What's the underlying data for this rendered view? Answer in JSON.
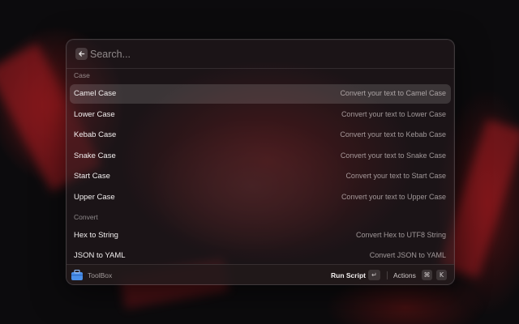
{
  "search": {
    "placeholder": "Search...",
    "value": ""
  },
  "sections": [
    {
      "title": "Case",
      "items": [
        {
          "title": "Camel Case",
          "subtitle": "Convert your text to Camel Case",
          "selected": true
        },
        {
          "title": "Lower Case",
          "subtitle": "Convert your text to Lower Case"
        },
        {
          "title": "Kebab Case",
          "subtitle": "Convert your text to Kebab Case"
        },
        {
          "title": "Snake Case",
          "subtitle": "Convert your text to Snake Case"
        },
        {
          "title": "Start Case",
          "subtitle": "Convert your text to Start Case"
        },
        {
          "title": "Upper Case",
          "subtitle": "Convert your text to Upper Case"
        }
      ]
    },
    {
      "title": "Convert",
      "items": [
        {
          "title": "Hex to String",
          "subtitle": "Convert Hex to UTF8 String"
        },
        {
          "title": "JSON to YAML",
          "subtitle": "Convert JSON to YAML"
        }
      ]
    }
  ],
  "footer": {
    "app_name": "ToolBox",
    "app_icon": "toolbox-icon",
    "primary_action": "Run Script",
    "primary_key": "↵",
    "actions_label": "Actions",
    "actions_keys": [
      "⌘",
      "K"
    ]
  },
  "colors": {
    "accent_red": "#a81c20",
    "selection": "#3a2e30",
    "app_icon_blue": "#4a8fe8"
  }
}
